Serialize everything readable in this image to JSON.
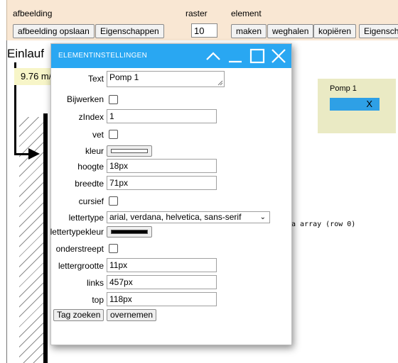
{
  "toolbar": {
    "section_afbeelding": "afbeelding",
    "section_raster": "raster",
    "section_element": "element",
    "btn_afbeelding_opslaan": "afbeelding opslaan",
    "btn_eigenschappen": "Eigenschappen",
    "raster_value": "10",
    "btn_maken": "maken",
    "btn_weghalen": "weghalen",
    "btn_kopieren": "kopiëren",
    "btn_eigenschappen_cut": "Eigenscha"
  },
  "canvas": {
    "einlauf_label": "Einlauf",
    "flowrate": "9.76 m/",
    "array_text": "a array (row 0)",
    "pomp_widget": {
      "title": "Pomp 1",
      "close": "X",
      "bar_color": "#2ea0e6"
    }
  },
  "dialog": {
    "title": "ELEMENTINSTELLINGEN",
    "icons": [
      "chevron-up-icon",
      "minimize-icon",
      "maximize-icon",
      "close-icon"
    ],
    "fields": {
      "text": {
        "label": "Text",
        "value": "Pomp 1"
      },
      "bijwerken": {
        "label": "Bijwerken",
        "checked": false
      },
      "zindex": {
        "label": "zIndex",
        "value": "1"
      },
      "vet": {
        "label": "vet",
        "checked": false
      },
      "kleur": {
        "label": "kleur",
        "color": "#ffffff"
      },
      "hoogte": {
        "label": "hoogte",
        "value": "18px"
      },
      "breedte": {
        "label": "breedte",
        "value": "71px"
      },
      "cursief": {
        "label": "cursief",
        "checked": false
      },
      "lettertype": {
        "label": "lettertype",
        "value": "arial, verdana, helvetica, sans-serif"
      },
      "lettertypekleur": {
        "label": "lettertypekleur",
        "color": "#000000"
      },
      "onderstreept": {
        "label": "onderstreept",
        "checked": false
      },
      "lettergrootte": {
        "label": "lettergrootte",
        "value": "11px"
      },
      "links": {
        "label": "links",
        "value": "457px"
      },
      "top": {
        "label": "top",
        "value": "118px"
      }
    },
    "btn_tag_zoeken": "Tag zoeken",
    "btn_overnemen": "overnemen",
    "accent_color": "#29a7f2"
  }
}
